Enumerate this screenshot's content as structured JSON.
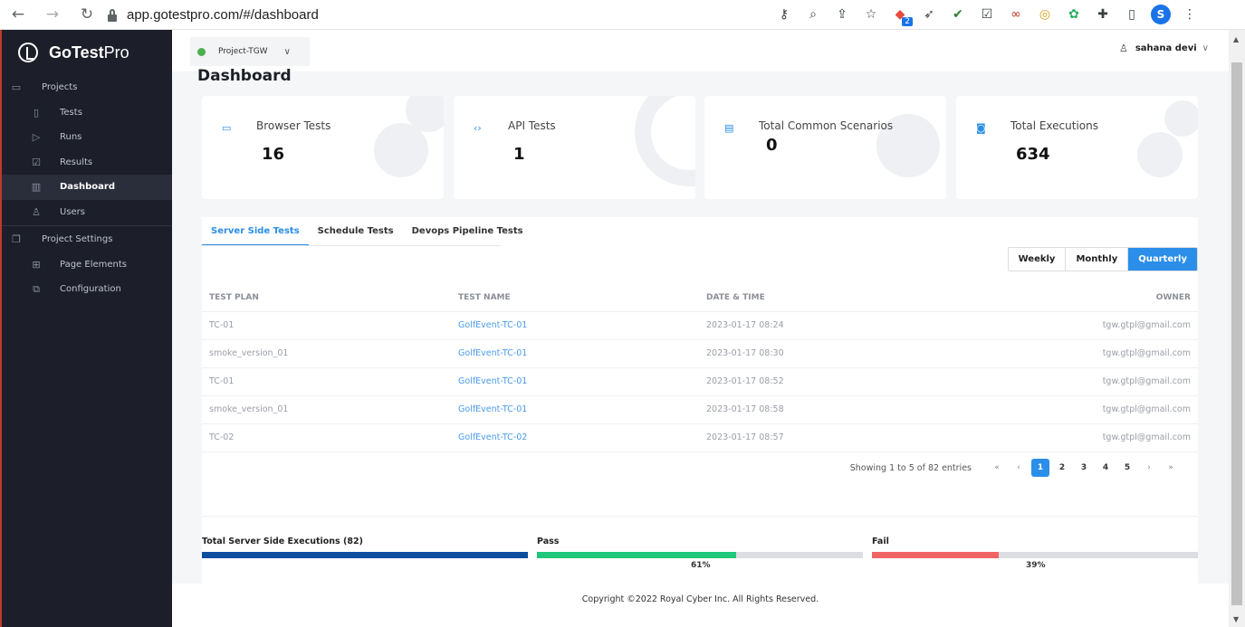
{
  "browser": {
    "url": "app.gotestpro.com/#/dashboard",
    "back": "←",
    "forward": "→",
    "reload": "↻",
    "ext_badge": "2",
    "profile_initial": "S"
  },
  "sidebar": {
    "brand_bold": "GoTest",
    "brand_light": "Pro",
    "items": [
      {
        "label": "Projects",
        "icon": "folder-icon"
      },
      {
        "label": "Tests",
        "icon": "file-icon"
      },
      {
        "label": "Runs",
        "icon": "play-icon"
      },
      {
        "label": "Results",
        "icon": "checkbox-icon"
      },
      {
        "label": "Dashboard",
        "icon": "bar-chart-icon"
      },
      {
        "label": "Users",
        "icon": "user-icon"
      },
      {
        "label": "Project Settings",
        "icon": "copy-icon"
      },
      {
        "label": "Page Elements",
        "icon": "grid-icon"
      },
      {
        "label": "Configuration",
        "icon": "config-icon"
      }
    ]
  },
  "header": {
    "project": "Project-TGW",
    "user": "sahana devi"
  },
  "page": {
    "title": "Dashboard"
  },
  "cards": [
    {
      "label": "Browser Tests",
      "value": "16",
      "icon": "browser-icon"
    },
    {
      "label": "API Tests",
      "value": "1",
      "icon": "api-icon"
    },
    {
      "label": "Total Common Scenarios",
      "value": "0",
      "icon": "document-icon"
    },
    {
      "label": "Total Executions",
      "value": "634",
      "icon": "executions-icon"
    }
  ],
  "tabs": [
    "Server Side Tests",
    "Schedule Tests",
    "Devops Pipeline Tests"
  ],
  "period": [
    "Weekly",
    "Monthly",
    "Quarterly"
  ],
  "table": {
    "headers": [
      "TEST PLAN",
      "TEST NAME",
      "DATE & TIME",
      "OWNER"
    ],
    "rows": [
      [
        "TC-01",
        "GolfEvent-TC-01",
        "2023-01-17 08:24",
        "tgw.gtpl@gmail.com"
      ],
      [
        "smoke_version_01",
        "GolfEvent-TC-01",
        "2023-01-17 08:30",
        "tgw.gtpl@gmail.com"
      ],
      [
        "TC-01",
        "GolfEvent-TC-01",
        "2023-01-17 08:52",
        "tgw.gtpl@gmail.com"
      ],
      [
        "smoke_version_01",
        "GolfEvent-TC-01",
        "2023-01-17 08:58",
        "tgw.gtpl@gmail.com"
      ],
      [
        "TC-02",
        "GolfEvent-TC-02",
        "2023-01-17 08:57",
        "tgw.gtpl@gmail.com"
      ]
    ]
  },
  "pagination": {
    "info": "Showing 1 to 5 of 82 entries",
    "first": "«",
    "prev": "‹",
    "pages": [
      "1",
      "2",
      "3",
      "4",
      "5"
    ],
    "next": "›",
    "last": "»"
  },
  "summary": {
    "total_label": "Total Server Side Executions (82)",
    "pass_label": "Pass",
    "pass_pct": "61%",
    "pass_fraction": 0.61,
    "fail_label": "Fail",
    "fail_pct": "39%",
    "fail_fraction": 0.39,
    "colors": {
      "total": "#0d4f9e",
      "pass": "#1ec77a",
      "fail": "#f06464"
    }
  },
  "footer": "Copyright ©2022 Royal Cyber Inc. All Rights Reserved."
}
